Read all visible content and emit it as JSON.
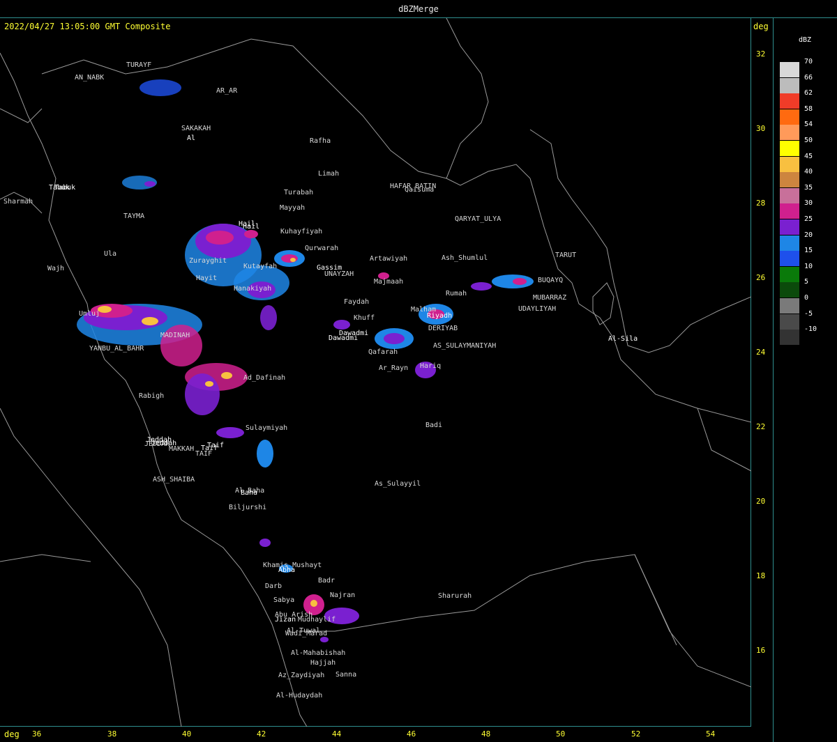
{
  "window": {
    "title": "dBZMerge"
  },
  "header": {
    "timestamp": "2022/04/27 13:05:00 GMT Composite",
    "lat_unit": "deg",
    "lon_unit": "deg"
  },
  "axes": {
    "lat_ticks": [
      "32",
      "30",
      "28",
      "26",
      "24",
      "22",
      "20",
      "18",
      "16"
    ],
    "lon_ticks": [
      "36",
      "38",
      "40",
      "42",
      "44",
      "46",
      "48",
      "50",
      "52",
      "54"
    ]
  },
  "legend": {
    "unit": "dBZ",
    "levels": [
      {
        "label": "70",
        "color": "#d8d8d8"
      },
      {
        "label": "66",
        "color": "#bcbcbc"
      },
      {
        "label": "62",
        "color": "#f03c28"
      },
      {
        "label": "58",
        "color": "#ff6a10"
      },
      {
        "label": "54",
        "color": "#ff9a5a"
      },
      {
        "label": "50",
        "color": "#ffff00"
      },
      {
        "label": "45",
        "color": "#f8c040"
      },
      {
        "label": "40",
        "color": "#cd853f"
      },
      {
        "label": "35",
        "color": "#c8709a"
      },
      {
        "label": "30",
        "color": "#d0208e"
      },
      {
        "label": "25",
        "color": "#7a20d0"
      },
      {
        "label": "20",
        "color": "#1e86e6"
      },
      {
        "label": "15",
        "color": "#1e50ec"
      },
      {
        "label": "10",
        "color": "#0a7a0a"
      },
      {
        "label": "5",
        "color": "#0b4a0b"
      },
      {
        "label": "0",
        "color": "#7a7a7a"
      },
      {
        "label": "-5",
        "color": "#4a4a4a"
      },
      {
        "label": "-10",
        "color": "#333333"
      }
    ]
  },
  "cities": [
    "AN_NABK",
    "TURAYF",
    "AR_AR",
    "SAKAKAH",
    "Al",
    "Rafha",
    "Limah",
    "Tabuk",
    "Tabuk",
    "HAFAR_BATIN",
    "Qaisuma",
    "Turabah",
    "Sharmah",
    "Mayyah",
    "TAYMA",
    "Hail",
    "Hail",
    "QARYAT_ULYA",
    "Kuhayfiyah",
    "Qurwarah",
    "Ula",
    "Zurayghit",
    "Kutayfah",
    "Gassim",
    "UNAYZAH",
    "Artawiyah",
    "Ash_Shumlul",
    "TARUT",
    "Wajh",
    "Hayit",
    "Majmaah",
    "BUQAYQ",
    "Hanakiyah",
    "Rumah",
    "MUBARRAZ",
    "Faydah",
    "UDAYLIYAH",
    "Umluj",
    "Malham",
    "Riyadh",
    "Khuff",
    "DERIYAB",
    "MADINAH",
    "Dawadmi",
    "Dawadmi",
    "AS_SULAYMANIYAH",
    "Al-Sila",
    "YANBU_AL_BAHR",
    "Qafarah",
    "Hariq",
    "Ad_Dafinah",
    "Ar_Rayn",
    "Rabigh",
    "Badi",
    "Sulaymiyah",
    "Jeddah",
    "Jeddah",
    "Taif",
    "Taif",
    "JEDDAH",
    "MAKKAH",
    "TAIF",
    "ASH_SHAIBA",
    "As_Sulayyil",
    "Al_Baha",
    "Baha",
    "Biljurshi",
    "Khamis_Mushayt",
    "Abha",
    "Badr",
    "Darb",
    "Najran",
    "Sabya",
    "Sharurah",
    "Abu_Arish",
    "Jizan",
    "Mudhaylif",
    "Al-Tuwal",
    "Wadi_Marad",
    "Al-Mahabishah",
    "Hajjah",
    "Az_Zaydiyah",
    "Sanna",
    "Al-Hudaydah"
  ]
}
